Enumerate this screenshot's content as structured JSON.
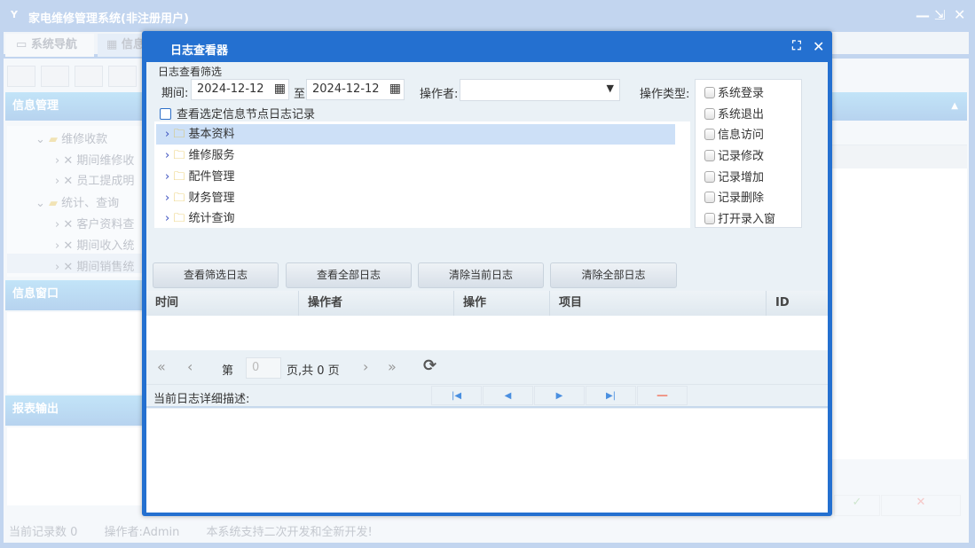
{
  "app": {
    "title": "家电维修管理系统(非注册用户)"
  },
  "tabs": [
    {
      "label": "系统导航"
    },
    {
      "label": "信息"
    }
  ],
  "left": {
    "section1": "信息管理",
    "tree": [
      {
        "label": "维修收款",
        "level": 0
      },
      {
        "label": "期间维修收",
        "level": 1
      },
      {
        "label": "员工提成明",
        "level": 1
      },
      {
        "label": "统计、查询",
        "level": 0
      },
      {
        "label": "客户资料查",
        "level": 1
      },
      {
        "label": "期间收入统",
        "level": 1
      },
      {
        "label": "期间销售统",
        "level": 1
      }
    ],
    "section2": "信息窗口",
    "section3": "报表输出"
  },
  "status": {
    "records": "当前记录数 0",
    "operator": "操作者:Admin",
    "note": "本系统支持二次开发和全新开发!"
  },
  "dialog": {
    "title": "日志查看器",
    "filter_title": "日志查看筛选",
    "period_label": "期间:",
    "date_from": "2024-12-12",
    "to_label": "至",
    "date_to": "2024-12-12",
    "operator_label": "操作者:",
    "operator_value": "",
    "optype_label": "操作类型:",
    "node_check_label": "查看选定信息节点日志记录",
    "tree": [
      {
        "label": "基本资料",
        "selected": true
      },
      {
        "label": "维修服务"
      },
      {
        "label": "配件管理"
      },
      {
        "label": "财务管理"
      },
      {
        "label": "统计查询"
      }
    ],
    "optypes": [
      "系统登录",
      "系统退出",
      "信息访问",
      "记录修改",
      "记录增加",
      "记录删除",
      "打开录入窗"
    ],
    "buttons": [
      "查看筛选日志",
      "查看全部日志",
      "清除当前日志",
      "清除全部日志"
    ],
    "columns": [
      "时间",
      "操作者",
      "操作",
      "项目",
      "ID"
    ],
    "pager": {
      "page_label": "第",
      "page_value": "0",
      "total_label": "页,共 0 页"
    },
    "detail_label": "当前日志详细描述:"
  }
}
